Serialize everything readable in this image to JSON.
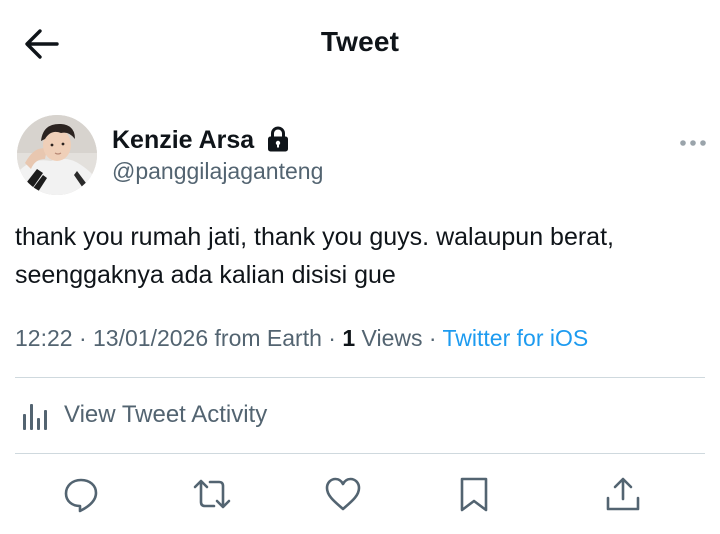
{
  "header": {
    "title": "Tweet",
    "back_icon": "arrow-left-icon"
  },
  "author": {
    "name": "Kenzie Arsa",
    "handle": "@panggilajaganteng",
    "protected_icon": "lock-icon",
    "more_icon": "more-horizontal-icon"
  },
  "tweet": {
    "text_line1": "thank you rumah jati, thank you guys. walaupun berat,",
    "text_line2": "seenggaknya ada kalian disisi gue"
  },
  "meta": {
    "time": "12:22",
    "separator": "·",
    "date": "13/01/2026",
    "location": "from Earth",
    "views_count": "1",
    "views_label": "Views",
    "client": "Twitter for iOS"
  },
  "activity": {
    "label": "View Tweet Activity",
    "icon": "bar-chart-icon"
  },
  "actions": [
    {
      "icon": "reply-icon"
    },
    {
      "icon": "retweet-icon"
    },
    {
      "icon": "like-icon"
    },
    {
      "icon": "bookmark-icon"
    },
    {
      "icon": "share-icon"
    }
  ],
  "colors": {
    "text": "#0f1419",
    "secondary": "#536471",
    "link": "#1d9bf0",
    "divider": "#cfd9de"
  }
}
